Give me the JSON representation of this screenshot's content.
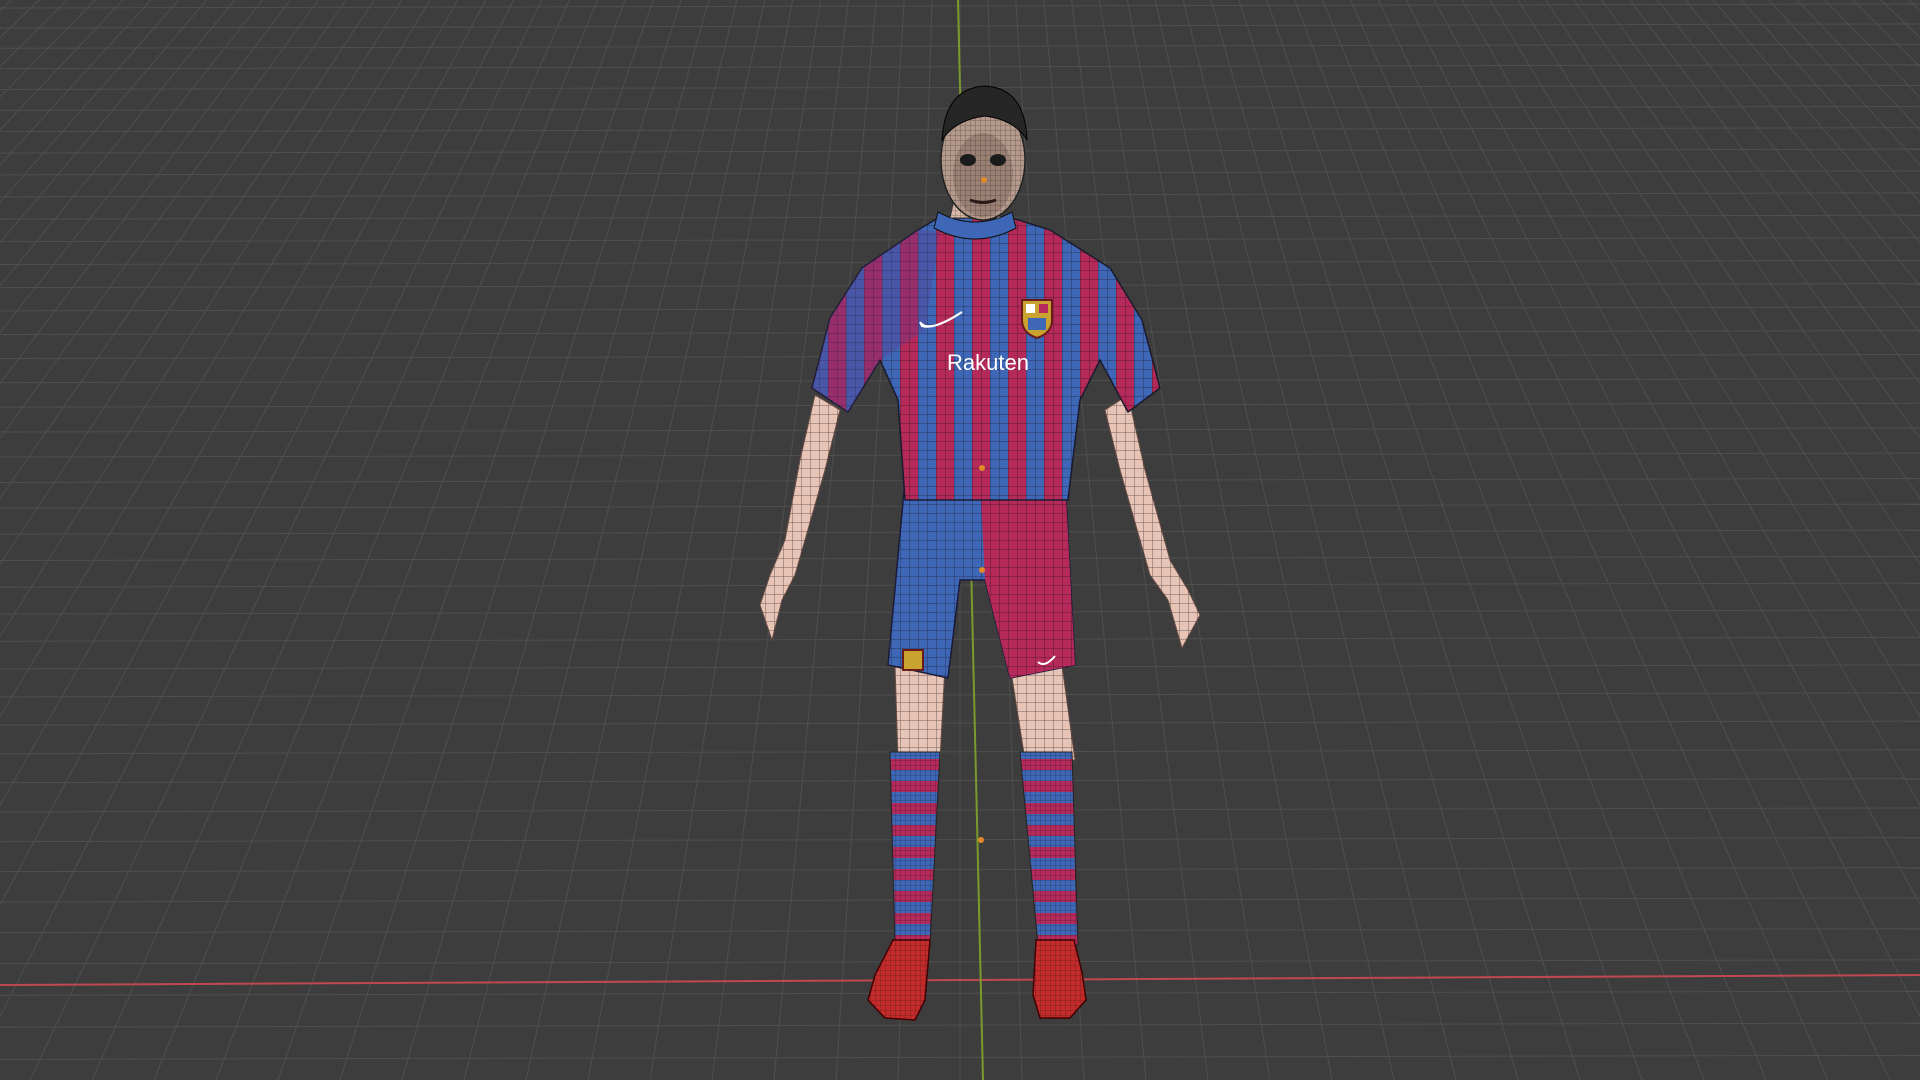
{
  "viewport": {
    "background": "#3d3d3d",
    "grid_color": "#4f4f4f",
    "x_axis_color": "#c0494f",
    "y_axis_color": "#7a9a2e"
  },
  "model": {
    "jersey_red": "#b62a5b",
    "jersey_blue": "#3f67b8",
    "skin": "#e7c4b6",
    "hair": "#262626",
    "boot": "#c62b2b",
    "wire": "#111111"
  },
  "jersey_text": {
    "sponsor": "Rakuten"
  },
  "icons": {
    "crest": "club-crest-icon",
    "swoosh": "swoosh-logo-icon"
  }
}
